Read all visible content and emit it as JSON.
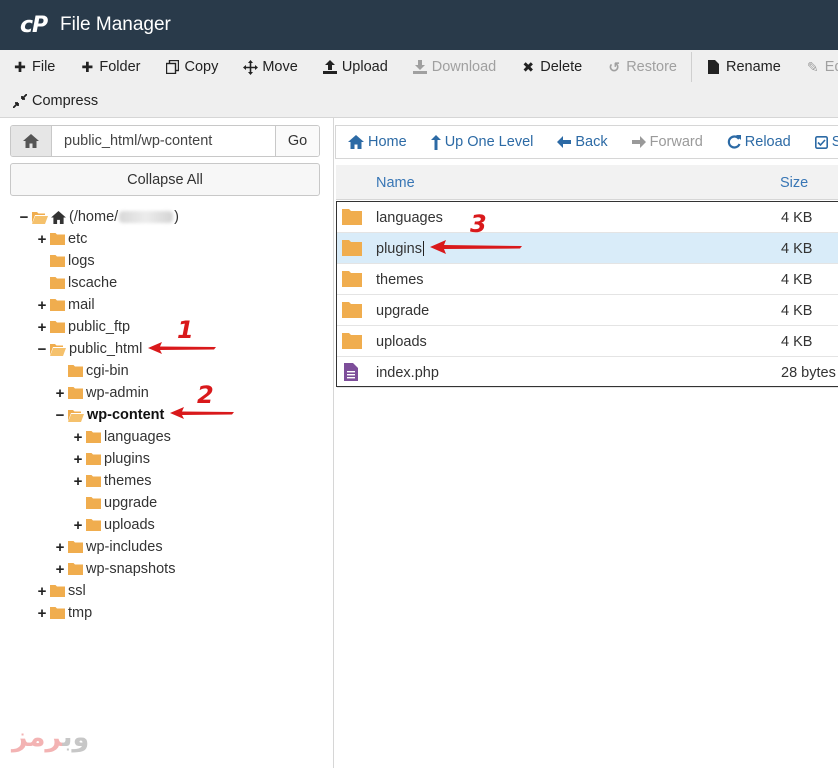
{
  "app": {
    "logo": "cP",
    "title": "File Manager"
  },
  "toolbar": {
    "row1": [
      {
        "label": "File",
        "icon": "plus-icon"
      },
      {
        "label": "Folder",
        "icon": "plus-icon"
      },
      {
        "label": "Copy",
        "icon": "copy-icon"
      },
      {
        "label": "Move",
        "icon": "move-icon"
      },
      {
        "label": "Upload",
        "icon": "upload-icon"
      },
      {
        "label": "Download",
        "icon": "download-icon"
      },
      {
        "label": "Delete",
        "icon": "delete-icon"
      },
      {
        "label": "Restore",
        "icon": "restore-icon"
      },
      {
        "label": "Rename",
        "icon": "rename-icon"
      },
      {
        "label": "Edit",
        "icon": "edit-icon"
      }
    ],
    "row2": [
      {
        "label": "Compress",
        "icon": "compress-icon"
      }
    ]
  },
  "path": {
    "value": "public_html/wp-content",
    "go_label": "Go"
  },
  "collapse_label": "Collapse All",
  "tree": {
    "root": {
      "label_prefix": "(/home/",
      "label_suffix": ")"
    },
    "items": [
      "etc",
      "logs",
      "lscache",
      "mail",
      "public_ftp",
      "public_html",
      "cgi-bin",
      "wp-admin",
      "wp-content",
      "languages",
      "plugins",
      "themes",
      "upgrade",
      "uploads",
      "wp-includes",
      "wp-snapshots",
      "ssl",
      "tmp"
    ]
  },
  "nav": {
    "home": "Home",
    "up": "Up One Level",
    "back": "Back",
    "forward": "Forward",
    "reload": "Reload",
    "select": "S"
  },
  "table": {
    "headers": {
      "name": "Name",
      "size": "Size"
    },
    "rows": [
      {
        "name": "languages",
        "size": "4 KB",
        "type": "folder"
      },
      {
        "name": "plugins",
        "size": "4 KB",
        "type": "folder"
      },
      {
        "name": "themes",
        "size": "4 KB",
        "type": "folder"
      },
      {
        "name": "upgrade",
        "size": "4 KB",
        "type": "folder"
      },
      {
        "name": "uploads",
        "size": "4 KB",
        "type": "folder"
      },
      {
        "name": "index.php",
        "size": "28 bytes",
        "type": "file"
      }
    ]
  },
  "annotations": [
    "1",
    "2",
    "3"
  ],
  "watermark": {
    "part1": "رمز",
    "part2": "وب"
  },
  "colors": {
    "titlebar": "#293a4a",
    "link": "#2c6aa5",
    "folder": "#f0ad4e",
    "php_file": "#7d4e9a",
    "selected_row": "#d9ecf9",
    "annotation": "#d9191b"
  }
}
